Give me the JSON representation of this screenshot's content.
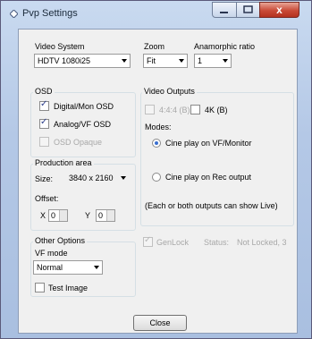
{
  "window": {
    "title": "Pvp Settings",
    "close_glyph": "x"
  },
  "video_system": {
    "label": "Video System",
    "value": "HDTV 1080i25"
  },
  "zoom": {
    "label": "Zoom",
    "value": "Fit"
  },
  "anamorphic": {
    "label": "Anamorphic ratio",
    "value": "1"
  },
  "osd": {
    "label": "OSD",
    "items": [
      {
        "label": "Digital/Mon OSD",
        "checked": true,
        "enabled": true
      },
      {
        "label": "Analog/VF OSD",
        "checked": true,
        "enabled": true
      },
      {
        "label": "OSD Opaque",
        "checked": false,
        "enabled": false
      }
    ]
  },
  "video_outputs": {
    "label": "Video Outputs",
    "opt_444": {
      "label": "4:4:4 (B)",
      "checked": false,
      "enabled": false
    },
    "opt_4k": {
      "label": "4K (B)",
      "checked": false,
      "enabled": true
    },
    "modes_label": "Modes:",
    "mode1": {
      "label": "Cine play on VF/Monitor",
      "selected": true
    },
    "mode2": {
      "label": "Cine play on Rec output",
      "selected": false
    },
    "note": "(Each or both outputs can show Live)"
  },
  "production": {
    "label": "Production area",
    "size_label": "Size:",
    "size_value": "3840 x 2160",
    "offset_label": "Offset:",
    "x_label": "X",
    "x_value": "0",
    "y_label": "Y",
    "y_value": "0"
  },
  "other": {
    "label": "Other Options",
    "vf_mode_label": "VF mode",
    "vf_mode_value": "Normal",
    "test_image": {
      "label": "Test Image",
      "checked": false
    }
  },
  "genlock": {
    "label": "GenLock",
    "checked": true,
    "enabled": false,
    "status_label": "Status:",
    "status_value": "Not Locked, 3"
  },
  "close_button": "Close"
}
